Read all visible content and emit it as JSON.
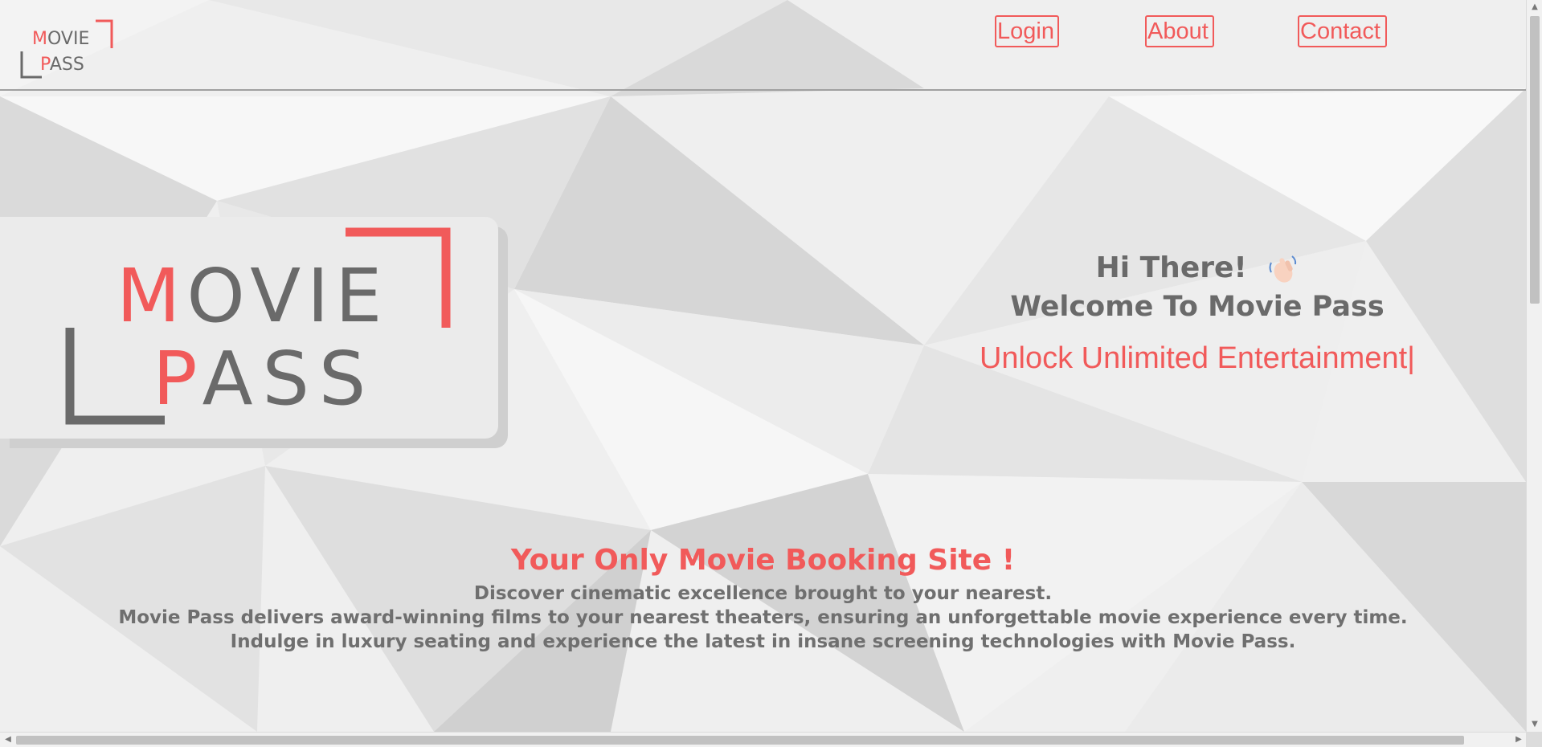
{
  "brand": {
    "logo_line1_accent": "M",
    "logo_line1_rest": "OVIE",
    "logo_line2_accent": "P",
    "logo_line2_rest": "ASS",
    "accent_color": "#f15a5a",
    "text_color": "#6a6a6a"
  },
  "nav": {
    "login": "Login",
    "about": "About",
    "contact": "Contact"
  },
  "hero": {
    "greeting": "Hi There!",
    "wave_icon": "waving-hand-icon",
    "welcome": "Welcome To Movie Pass",
    "tagline": "Unlock Unlimited Entertainment",
    "cursor": "|"
  },
  "about": {
    "heading": "Your Only Movie Booking Site !",
    "line1": "Discover cinematic excellence brought to your nearest.",
    "line2": "Movie Pass delivers award-winning films to your nearest theaters, ensuring an unforgettable movie experience every time.",
    "line3": "Indulge in luxury seating and experience the latest in insane screening technologies with Movie Pass."
  }
}
